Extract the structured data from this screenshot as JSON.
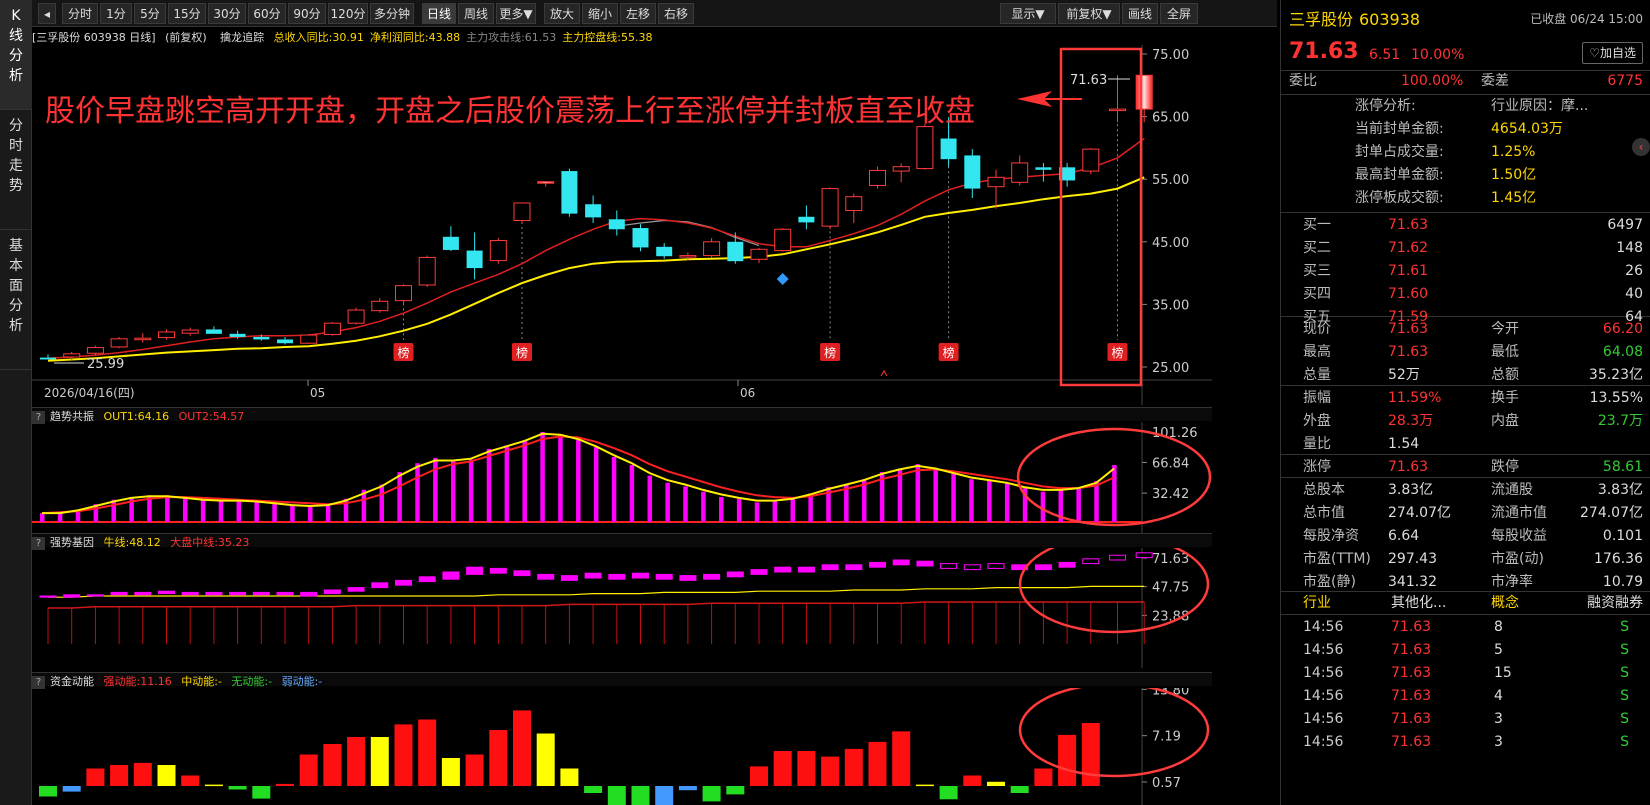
{
  "sidebar": {
    "tabs": [
      "K\n线\n分\n析",
      "分\n时\n走\n势",
      "基\n本\n面\n分\n析"
    ]
  },
  "toolbar": {
    "nav_icon": "left-arrow-icon",
    "buttons": [
      "分时",
      "1分",
      "5分",
      "15分",
      "30分",
      "60分",
      "90分",
      "120分",
      "多分钟",
      "日线",
      "周线",
      "更多▼",
      "放大",
      "缩小",
      "左移",
      "右移"
    ],
    "selected": "日线",
    "right_buttons": [
      "显示▼",
      "前复权▼",
      "画线",
      "全屏"
    ]
  },
  "main_header": {
    "stock": "[三孚股份 603938 日线]",
    "adj": "(前复权)",
    "indicator": "擒龙追踪",
    "items": [
      {
        "label": "总收入同比:30.91",
        "color": "#ffd700"
      },
      {
        "label": "净利润同比:43.88",
        "color": "#ffd700"
      },
      {
        "label": "主力攻击线:61.53",
        "color": "#888888"
      },
      {
        "label": "主力控盘线:55.38",
        "color": "#ffd700"
      }
    ]
  },
  "annotation": {
    "text": "股价早盘跳空高开开盘，开盘之后股价震荡上行至涨停并封板直至收盘",
    "color": "#ff3333"
  },
  "kline": {
    "y_ticks": [
      "75.00",
      "65.00",
      "55.00",
      "45.00",
      "35.00",
      "25.00"
    ],
    "x_labels": [
      "2026/04/16(四)",
      "05",
      "06"
    ],
    "min_label": "25.99",
    "max_label": "71.63",
    "badge": "榜"
  },
  "panel2": {
    "name": "趋势共振",
    "out1": "OUT1:64.16",
    "out2": "OUT2:54.57",
    "y_ticks": [
      "101.26",
      "66.84",
      "32.42"
    ]
  },
  "panel3": {
    "name": "强势基因",
    "niu": "牛线:48.12",
    "dapan": "大盘中线:35.23",
    "y_ticks": [
      "71.63",
      "47.75",
      "23.88"
    ]
  },
  "panel4": {
    "name": "资金动能",
    "strong": "强动能:11.16",
    "mid": "中动能:-",
    "none": "无动能:-",
    "weak": "弱动能:-",
    "y_ticks": [
      "13.80",
      "7.19",
      "0.57"
    ]
  },
  "chart_data": {
    "type": "candlestick",
    "ylim": [
      25,
      75
    ],
    "candles": [
      [
        26.5,
        27.0,
        26.2,
        26.2
      ],
      [
        26.6,
        27.4,
        26.0,
        27.1
      ],
      [
        27.2,
        28.4,
        26.9,
        28.1
      ],
      [
        28.2,
        29.8,
        28.0,
        29.5
      ],
      [
        29.4,
        30.4,
        28.9,
        29.6
      ],
      [
        29.7,
        31.0,
        29.4,
        30.6
      ],
      [
        30.4,
        31.3,
        30.0,
        30.9
      ],
      [
        31.0,
        31.5,
        30.5,
        30.3
      ],
      [
        30.3,
        30.8,
        29.5,
        29.8
      ],
      [
        29.8,
        30.2,
        29.2,
        29.4
      ],
      [
        29.4,
        29.8,
        28.6,
        28.8
      ],
      [
        28.8,
        30.3,
        28.7,
        30.1
      ],
      [
        30.2,
        32.2,
        30.0,
        32.0
      ],
      [
        32.0,
        34.5,
        31.8,
        34.1
      ],
      [
        34.0,
        36.0,
        33.7,
        35.5
      ],
      [
        35.6,
        38.2,
        35.2,
        38.0
      ],
      [
        38.1,
        42.8,
        37.8,
        42.5
      ],
      [
        45.8,
        47.5,
        43.5,
        43.7
      ],
      [
        43.6,
        46.5,
        39.0,
        40.8
      ],
      [
        42.0,
        45.6,
        41.5,
        45.2
      ],
      [
        48.4,
        51.2,
        48.0,
        51.2
      ],
      [
        54.6,
        54.6,
        53.8,
        54.6
      ],
      [
        56.3,
        56.7,
        49.0,
        49.5
      ],
      [
        51.0,
        52.4,
        48.0,
        48.9
      ],
      [
        48.6,
        50.0,
        46.0,
        47.0
      ],
      [
        47.2,
        47.8,
        43.5,
        44.1
      ],
      [
        44.2,
        44.8,
        42.3,
        42.7
      ],
      [
        42.7,
        43.3,
        42.0,
        42.8
      ],
      [
        42.8,
        45.6,
        42.5,
        45.0
      ],
      [
        45.0,
        46.5,
        41.5,
        41.9
      ],
      [
        42.2,
        44.0,
        41.6,
        43.8
      ],
      [
        43.6,
        47.2,
        43.4,
        47.0
      ],
      [
        49.0,
        50.8,
        47.0,
        48.1
      ],
      [
        47.5,
        53.7,
        47.0,
        53.5
      ],
      [
        50.0,
        52.7,
        48.0,
        52.2
      ],
      [
        54.0,
        57.0,
        53.5,
        56.4
      ],
      [
        56.3,
        57.5,
        54.5,
        57.0
      ],
      [
        56.7,
        63.8,
        56.5,
        63.4
      ],
      [
        61.5,
        64.9,
        57.0,
        58.2
      ],
      [
        58.8,
        59.8,
        52.0,
        53.5
      ],
      [
        53.8,
        56.5,
        50.3,
        55.3
      ],
      [
        54.5,
        58.8,
        54.0,
        57.6
      ],
      [
        56.9,
        57.6,
        54.6,
        56.5
      ],
      [
        56.9,
        57.6,
        53.8,
        54.8
      ],
      [
        56.3,
        60.0,
        55.8,
        59.8
      ],
      [
        66.2,
        71.6,
        64.1,
        66.2
      ],
      [
        66.2,
        71.6,
        64.1,
        71.6
      ]
    ],
    "ma_red": [
      26.4,
      26.6,
      26.9,
      27.3,
      27.8,
      28.4,
      29.0,
      29.5,
      29.8,
      30.0,
      30.0,
      30.1,
      30.6,
      31.3,
      32.3,
      33.6,
      35.2,
      37.0,
      38.4,
      39.8,
      41.5,
      43.6,
      45.4,
      47.0,
      48.3,
      48.7,
      48.5,
      48.0,
      47.2,
      45.9,
      44.7,
      44.2,
      44.2,
      45.2,
      46.3,
      47.6,
      49.4,
      51.5,
      53.3,
      54.4,
      55.0,
      55.3,
      55.6,
      55.9,
      56.8,
      58.4,
      61.5
    ],
    "ma_gray": [
      null,
      null,
      null,
      null,
      null,
      null,
      null,
      null,
      null,
      null,
      null,
      null,
      null,
      null,
      null,
      null,
      null,
      null,
      null,
      null,
      null,
      null,
      null,
      null,
      47.5,
      48.0,
      48.4,
      48.2,
      47.3,
      45.7,
      44.4
    ],
    "ma_yellow": [
      26.0,
      26.2,
      26.4,
      26.7,
      27.0,
      27.3,
      27.5,
      27.7,
      27.9,
      28.0,
      28.2,
      28.3,
      28.7,
      29.2,
      29.9,
      30.8,
      31.9,
      33.4,
      35.1,
      36.8,
      38.4,
      39.7,
      40.8,
      41.5,
      41.8,
      41.9,
      42.0,
      42.2,
      42.3,
      42.4,
      42.6,
      43.0,
      43.8,
      44.6,
      45.5,
      46.5,
      47.7,
      49.0,
      49.6,
      50.1,
      50.7,
      51.2,
      51.8,
      52.3,
      52.7,
      53.5,
      55.3
    ],
    "badge_idx": [
      15,
      20,
      33,
      38,
      45
    ],
    "p2": {
      "ylim": [
        0,
        110
      ],
      "bars": [
        10,
        10,
        14,
        20,
        25,
        28,
        30,
        30,
        27,
        25,
        24,
        24,
        24,
        20,
        19,
        18,
        18,
        26,
        36,
        42,
        56,
        66,
        72,
        68,
        70,
        82,
        86,
        92,
        101,
        98,
        92,
        84,
        73,
        64,
        52,
        44,
        40,
        34,
        28,
        26,
        22,
        24,
        27,
        32,
        39,
        42,
        48,
        56,
        60,
        65,
        60,
        54,
        48,
        46,
        44,
        38,
        34,
        36,
        38,
        46,
        64
      ],
      "out1": [
        10,
        10,
        13,
        18,
        23,
        27,
        29,
        29,
        27,
        25,
        24,
        24,
        23,
        21,
        19,
        18,
        19,
        24,
        32,
        40,
        52,
        62,
        69,
        69,
        71,
        79,
        85,
        91,
        99,
        98,
        93,
        85,
        75,
        66,
        55,
        47,
        42,
        36,
        31,
        27,
        24,
        24,
        26,
        31,
        37,
        42,
        47,
        54,
        59,
        63,
        60,
        55,
        50,
        47,
        44,
        39,
        36,
        36,
        38,
        44,
        60
      ],
      "out2": [
        10,
        11,
        12,
        15,
        19,
        23,
        26,
        28,
        28,
        27,
        26,
        25,
        24,
        23,
        22,
        21,
        20,
        21,
        25,
        31,
        40,
        50,
        59,
        65,
        68,
        74,
        80,
        86,
        93,
        96,
        95,
        90,
        83,
        75,
        65,
        57,
        51,
        45,
        39,
        34,
        30,
        28,
        27,
        29,
        33,
        37,
        42,
        48,
        53,
        58,
        59,
        57,
        54,
        51,
        48,
        44,
        40,
        38,
        38,
        41,
        50
      ]
    },
    "p3": {
      "ylim": [
        0,
        80
      ],
      "bodies": [
        [
          39,
          40
        ],
        [
          39,
          41
        ],
        [
          40,
          41
        ],
        [
          41,
          43
        ],
        [
          41,
          43
        ],
        [
          42,
          44
        ],
        [
          41,
          43
        ],
        [
          41,
          43
        ],
        [
          41,
          43
        ],
        [
          41,
          43
        ],
        [
          41,
          43
        ],
        [
          40,
          43
        ],
        [
          42,
          45
        ],
        [
          44,
          47
        ],
        [
          47,
          51
        ],
        [
          49,
          53
        ],
        [
          52,
          56
        ],
        [
          54,
          60
        ],
        [
          58,
          64
        ],
        [
          59,
          63
        ],
        [
          57,
          61
        ],
        [
          54,
          58
        ],
        [
          53,
          57
        ],
        [
          55,
          59
        ],
        [
          54,
          58
        ],
        [
          55,
          59
        ],
        [
          54,
          58
        ],
        [
          53,
          57
        ],
        [
          54,
          58
        ],
        [
          56,
          60
        ],
        [
          58,
          62
        ],
        [
          60,
          64
        ],
        [
          60,
          64
        ],
        [
          62,
          66
        ],
        [
          62,
          66
        ],
        [
          64,
          68
        ],
        [
          66,
          70
        ],
        [
          65,
          69
        ],
        [
          63,
          67
        ],
        [
          62,
          66
        ],
        [
          63,
          67
        ],
        [
          62,
          66
        ],
        [
          62,
          66
        ],
        [
          64,
          68
        ],
        [
          67,
          71
        ],
        [
          70,
          74
        ],
        [
          72,
          76
        ]
      ],
      "niu": [
        39,
        39,
        40,
        40,
        40,
        40,
        40,
        40,
        40,
        40,
        40,
        40,
        40,
        40,
        40,
        40,
        40,
        40,
        40,
        41,
        41,
        41,
        41,
        42,
        42,
        42,
        43,
        43,
        43,
        43,
        44,
        44,
        44,
        44,
        45,
        45,
        45,
        46,
        46,
        46,
        47,
        47,
        47,
        47,
        48,
        48,
        48
      ],
      "dapan": [
        30,
        30,
        31,
        31,
        31,
        31,
        31,
        31,
        31,
        31,
        31,
        31,
        31,
        32,
        32,
        32,
        32,
        32,
        32,
        32,
        32,
        32,
        33,
        33,
        33,
        33,
        33,
        33,
        34,
        34,
        34,
        34,
        34,
        34,
        34,
        34,
        34,
        35,
        35,
        35,
        35,
        35,
        35,
        35,
        35,
        35,
        35
      ]
    },
    "p4": {
      "ylim": [
        -2,
        14
      ],
      "bars": [
        [
          -1.5,
          "green"
        ],
        [
          -0.8,
          "blue"
        ],
        [
          2.5,
          "red"
        ],
        [
          3.0,
          "red"
        ],
        [
          3.3,
          "red"
        ],
        [
          3.0,
          "yellow"
        ],
        [
          1.5,
          "red"
        ],
        [
          0.2,
          "yellow"
        ],
        [
          -0.5,
          "green"
        ],
        [
          -1.8,
          "green"
        ],
        [
          0.3,
          "red"
        ],
        [
          4.5,
          "red"
        ],
        [
          6.0,
          "red"
        ],
        [
          7.0,
          "red"
        ],
        [
          7.0,
          "yellow"
        ],
        [
          8.8,
          "red"
        ],
        [
          9.5,
          "red"
        ],
        [
          4.0,
          "yellow"
        ],
        [
          4.5,
          "red"
        ],
        [
          8.0,
          "red"
        ],
        [
          10.8,
          "red"
        ],
        [
          7.5,
          "yellow"
        ],
        [
          2.5,
          "yellow"
        ],
        [
          -1.0,
          "green"
        ],
        [
          -4.5,
          "green"
        ],
        [
          -4.5,
          "green"
        ],
        [
          -3.8,
          "blue"
        ],
        [
          -0.6,
          "blue"
        ],
        [
          -2.2,
          "green"
        ],
        [
          -1.2,
          "green"
        ],
        [
          2.8,
          "red"
        ],
        [
          5.0,
          "red"
        ],
        [
          5.0,
          "red"
        ],
        [
          4.2,
          "red"
        ],
        [
          5.3,
          "red"
        ],
        [
          6.3,
          "red"
        ],
        [
          7.8,
          "red"
        ],
        [
          0.2,
          "yellow"
        ],
        [
          -1.9,
          "green"
        ],
        [
          1.5,
          "red"
        ],
        [
          0.6,
          "yellow"
        ],
        [
          -1.0,
          "green"
        ],
        [
          2.5,
          "red"
        ],
        [
          7.3,
          "red"
        ],
        [
          9.0,
          "red"
        ]
      ]
    }
  },
  "right": {
    "name": "三孚股份",
    "code": "603938",
    "status": "已收盘 06/24 15:00",
    "price": "71.63",
    "change": "6.51",
    "pct": "10.00%",
    "watch": "♡加自选",
    "weibi_label": "委比",
    "weibi": "100.00%",
    "weicha_label": "委差",
    "weicha": "6775",
    "info": [
      [
        "涨停分析:",
        "行业原因：摩..."
      ],
      [
        "当前封单金额:",
        "4654.03万"
      ],
      [
        "封单占成交量:",
        "1.25%"
      ],
      [
        "最高封单金额:",
        "1.50亿"
      ],
      [
        "涨停板成交额:",
        "1.45亿"
      ]
    ],
    "bids": [
      [
        "买一",
        "71.63",
        "6497"
      ],
      [
        "买二",
        "71.62",
        "148"
      ],
      [
        "买三",
        "71.61",
        "26"
      ],
      [
        "买四",
        "71.60",
        "40"
      ],
      [
        "买五",
        "71.59",
        "64"
      ]
    ],
    "quote": [
      [
        "现价",
        "71.63",
        "今开",
        "66.20"
      ],
      [
        "最高",
        "71.63",
        "最低",
        "64.08"
      ],
      [
        "总量",
        "52万",
        "总额",
        "35.23亿"
      ]
    ],
    "quote2": [
      [
        "振幅",
        "11.59%",
        "换手",
        "13.55%"
      ],
      [
        "外盘",
        "28.3万",
        "内盘",
        "23.7万"
      ],
      [
        "量比",
        "1.54",
        "",
        ""
      ]
    ],
    "quote3": [
      [
        "涨停",
        "71.63",
        "跌停",
        "58.61"
      ]
    ],
    "fund": [
      [
        "总股本",
        "3.83亿",
        "流通股",
        "3.83亿"
      ],
      [
        "总市值",
        "274.07亿",
        "流通市值",
        "274.07亿"
      ],
      [
        "每股净资",
        "6.64",
        "每股收益",
        "0.101"
      ],
      [
        "市盈(TTM)",
        "297.43",
        "市盈(动)",
        "176.36"
      ],
      [
        "市盈(静)",
        "341.32",
        "市净率",
        "10.79"
      ]
    ],
    "tags": [
      "行业",
      "其他化...",
      "概念",
      "融资融券"
    ],
    "ticks": [
      [
        "14:56",
        "71.63",
        "8",
        "S"
      ],
      [
        "14:56",
        "71.63",
        "5",
        "S"
      ],
      [
        "14:56",
        "71.63",
        "15",
        "S"
      ],
      [
        "14:56",
        "71.63",
        "4",
        "S"
      ],
      [
        "14:56",
        "71.63",
        "3",
        "S"
      ],
      [
        "14:56",
        "71.63",
        "3",
        "S"
      ]
    ]
  }
}
